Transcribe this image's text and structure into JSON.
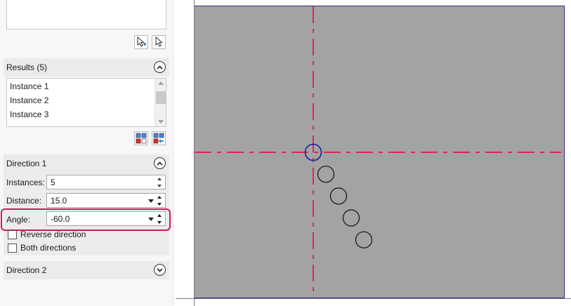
{
  "results": {
    "title": "Results (5)",
    "items": [
      "Instance 1",
      "Instance 2",
      "Instance 3"
    ]
  },
  "direction1": {
    "title": "Direction 1",
    "instances_label": "Instances:",
    "instances_value": "5",
    "distance_label": "Distance:",
    "distance_value": "15.0",
    "angle_label": "Angle:",
    "angle_value": "-60.0",
    "reverse_label": "Reverse direction",
    "both_label": "Both directions"
  },
  "direction2": {
    "title": "Direction 2"
  },
  "icons": {
    "add_pick": "cursor-add-icon",
    "pick": "cursor-icon",
    "result_a": "pattern-select-icon",
    "result_b": "pattern-arrow-icon",
    "collapse": "chevron-up-icon",
    "expand": "chevron-down-icon"
  },
  "colors": {
    "viewport_bg": "#a3a3a3",
    "axis_line": "#e0245e",
    "instance_origin": "#1a1aa0",
    "highlight": "#d0185a"
  },
  "pattern": {
    "instances": 5,
    "distance": 15.0,
    "angle": -60.0
  }
}
